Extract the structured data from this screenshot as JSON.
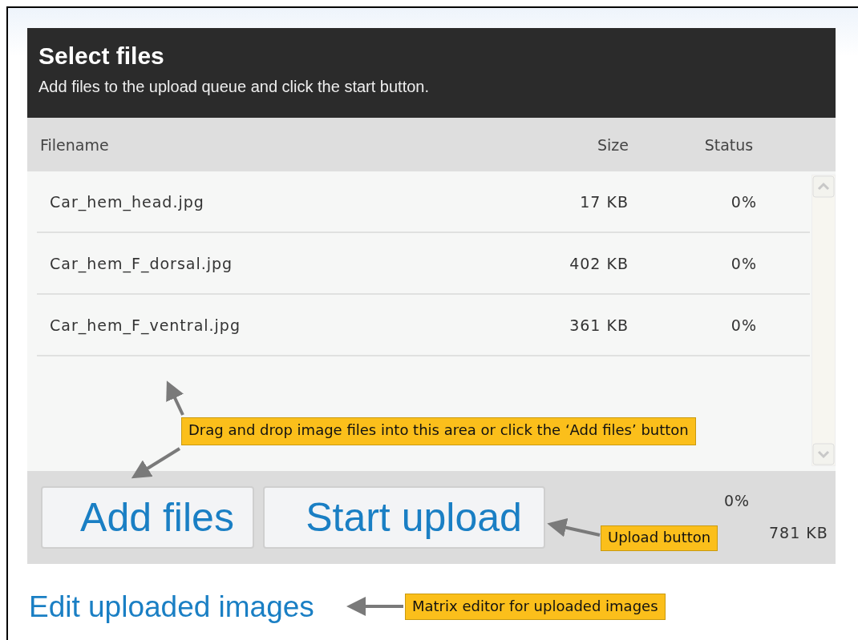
{
  "header": {
    "title": "Select files",
    "subtitle": "Add files to the upload queue and click the start button."
  },
  "columns": [
    "Filename",
    "Size",
    "Status"
  ],
  "files": [
    {
      "name": "Car_hem_head.jpg",
      "size": "17 KB",
      "status": "0%"
    },
    {
      "name": "Car_hem_F_dorsal.jpg",
      "size": "402 KB",
      "status": "0%"
    },
    {
      "name": "Car_hem_F_ventral.jpg",
      "size": "361 KB",
      "status": "0%"
    }
  ],
  "buttons": [
    "Add files",
    "Start upload"
  ],
  "totals": {
    "status": "0%",
    "size": "781 KB"
  },
  "link": "Edit uploaded images",
  "annotations": [
    {
      "kind": "dropzone",
      "text": "Drag and drop image files into this area or click the ‘Add files’ button"
    },
    {
      "kind": "upload",
      "text": "Upload button"
    },
    {
      "kind": "editor",
      "text": "Matrix editor for uploaded images"
    }
  ]
}
